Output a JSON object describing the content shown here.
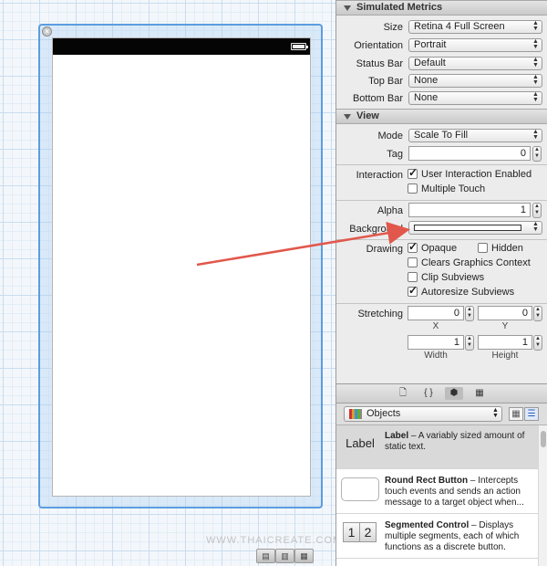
{
  "canvas": {
    "watermark": "WWW.THAICREATE.COM",
    "zoom_buttons": [
      "▤",
      "▥",
      "▦"
    ]
  },
  "inspector": {
    "simulated_metrics": {
      "header": "Simulated Metrics",
      "size_label": "Size",
      "size_value": "Retina 4 Full Screen",
      "orientation_label": "Orientation",
      "orientation_value": "Portrait",
      "status_bar_label": "Status Bar",
      "status_bar_value": "Default",
      "top_bar_label": "Top Bar",
      "top_bar_value": "None",
      "bottom_bar_label": "Bottom Bar",
      "bottom_bar_value": "None"
    },
    "view": {
      "header": "View",
      "mode_label": "Mode",
      "mode_value": "Scale To Fill",
      "tag_label": "Tag",
      "tag_value": "0",
      "interaction_label": "Interaction",
      "user_interaction": "User Interaction Enabled",
      "multiple_touch": "Multiple Touch",
      "alpha_label": "Alpha",
      "alpha_value": "1",
      "background_label": "Background",
      "drawing_label": "Drawing",
      "opaque": "Opaque",
      "hidden": "Hidden",
      "clears_graphics": "Clears Graphics Context",
      "clip_subviews": "Clip Subviews",
      "autoresize": "Autoresize Subviews",
      "stretching_label": "Stretching",
      "stretch_x": "0",
      "stretch_y": "0",
      "stretch_width": "1",
      "stretch_height": "1",
      "x_label": "X",
      "y_label": "Y",
      "width_label": "Width",
      "height_label": "Height"
    }
  },
  "library": {
    "tabs": [
      "🗋",
      "{ }",
      "⬢",
      "▦"
    ],
    "filter_value": "Objects",
    "items": [
      {
        "thumb": "Label",
        "title": "Label",
        "desc": " – A variably sized amount of static text."
      },
      {
        "thumb": "",
        "title": "Round Rect Button",
        "desc": " – Intercepts touch events and sends an action message to a target object when..."
      },
      {
        "thumb": "",
        "title": "Segmented Control",
        "desc": " – Displays multiple segments, each of which functions as a discrete button.",
        "segments": [
          "1",
          "2"
        ]
      }
    ]
  },
  "colors": {
    "selection_frame": "#5b9de0",
    "arrow": "#e2574c"
  }
}
